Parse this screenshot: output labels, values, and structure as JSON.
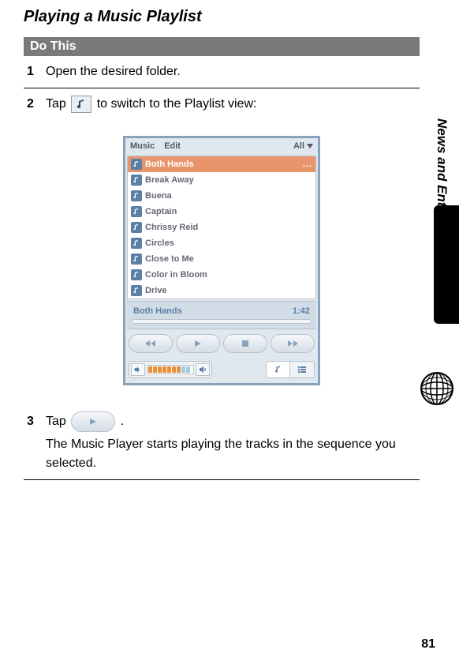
{
  "title": "Playing a Music Playlist",
  "do_this": "Do This",
  "side_label": "News and Entertainment",
  "page_number": "81",
  "steps": {
    "s1": {
      "num": "1",
      "text": "Open the desired folder."
    },
    "s2": {
      "num": "2",
      "pre": "Tap ",
      "post": " to switch to the Playlist view:"
    },
    "s3": {
      "num": "3",
      "pre": "Tap ",
      "post": ".",
      "desc": "The Music Player starts playing the tracks in the sequence you selected."
    }
  },
  "device": {
    "menu_music": "Music",
    "menu_edit": "Edit",
    "menu_all": "All",
    "tracks": [
      {
        "name": "Both Hands",
        "selected": true,
        "dots": "..."
      },
      {
        "name": "Break Away"
      },
      {
        "name": "Buena"
      },
      {
        "name": "Captain"
      },
      {
        "name": "Chrissy Reid"
      },
      {
        "name": "Circles"
      },
      {
        "name": "Close to Me"
      },
      {
        "name": "Color in Bloom"
      },
      {
        "name": "Drive"
      }
    ],
    "now_playing": {
      "title": "Both Hands",
      "time": "1:42"
    }
  }
}
